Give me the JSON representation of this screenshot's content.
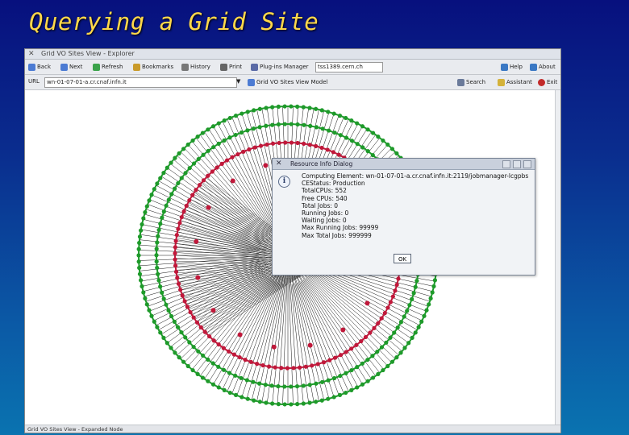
{
  "slide": {
    "title": "Querying a Grid Site"
  },
  "window": {
    "title": "Grid VO Sites View - Explorer",
    "status_text": "Grid VO Sites View - Expanded Node"
  },
  "toolbar": {
    "back": "Back",
    "next": "Next",
    "refresh": "Refresh",
    "bookmarks": "Bookmarks",
    "history": "History",
    "print": "Print",
    "plugins": "Plug-ins Manager",
    "host": "tss1389.cern.ch",
    "help": "Help",
    "about": "About"
  },
  "address": {
    "label": "URL",
    "value": "wn-01-07-01-a.cr.cnaf.infn.it",
    "model": "Grid VO Sites View Model",
    "search": "Search",
    "assistant": "Assistant",
    "exit": "Exit"
  },
  "dialog": {
    "title": "Resource Info Dialog",
    "lines": [
      "Computing Element: wn-01-07-01-a.cr.cnaf.infn.it:2119/jobmanager-lcgpbs",
      "CEStatus: Production",
      "TotalCPUs: 552",
      "Free CPUs: 540",
      "Total Jobs: 0",
      "Running Jobs: 0",
      "Waiting Jobs: 0",
      "Max Running Jobs: 99999",
      "Max Total Jobs: 999999"
    ],
    "ok_label": "OK"
  },
  "colors": {
    "outer_node": "#1e9a2a",
    "inner_node": "#c0183a",
    "edge": "#111111"
  }
}
